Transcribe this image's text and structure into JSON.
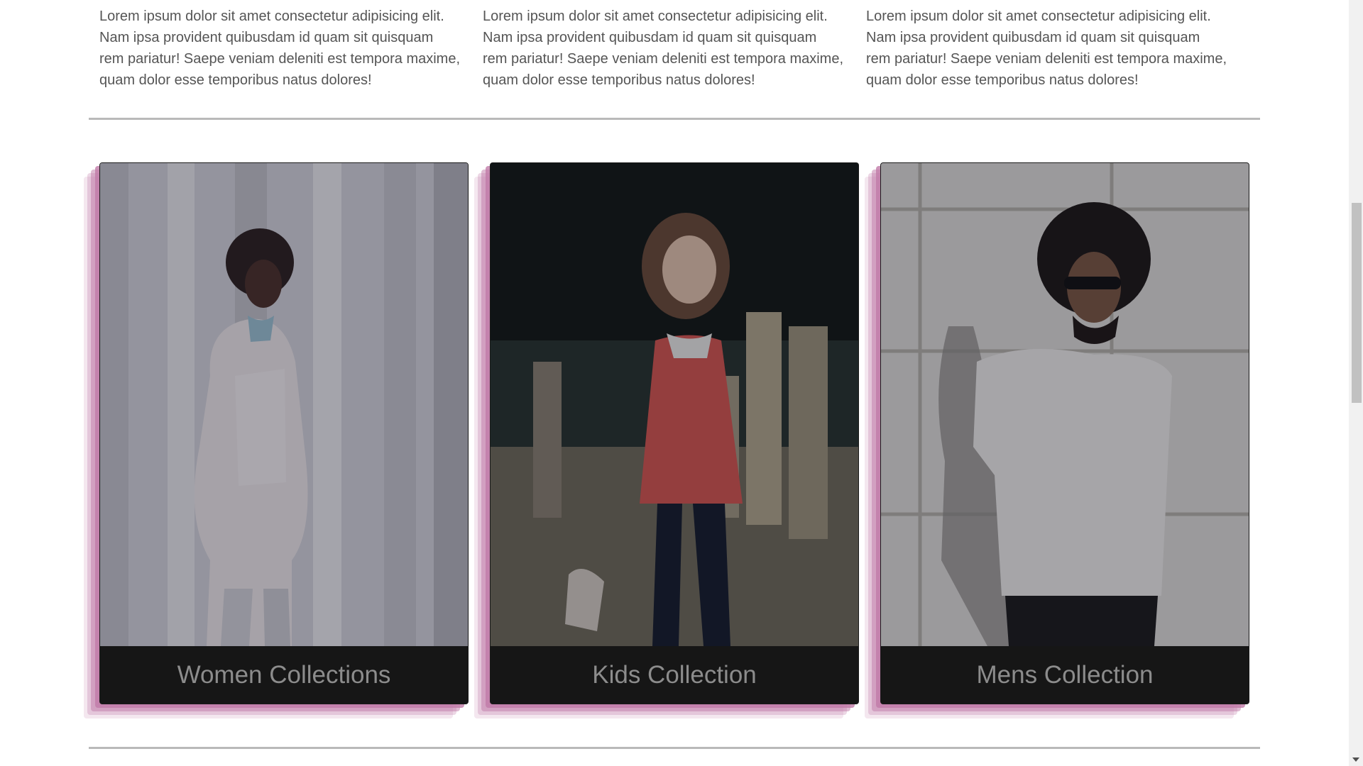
{
  "intro_columns": [
    {
      "text": "Lorem ipsum dolor sit amet consectetur adipisicing elit. Nam ipsa provident quibusdam id quam sit quisquam rem pariatur! Saepe veniam deleniti est tempora maxime, quam dolor esse temporibus natus dolores!"
    },
    {
      "text": "Lorem ipsum dolor sit amet consectetur adipisicing elit. Nam ipsa provident quibusdam id quam sit quisquam rem pariatur! Saepe veniam deleniti est tempora maxime, quam dolor esse temporibus natus dolores!"
    },
    {
      "text": "Lorem ipsum dolor sit amet consectetur adipisicing elit. Nam ipsa provident quibusdam id quam sit quisquam rem pariatur! Saepe veniam deleniti est tempora maxime, quam dolor esse temporibus natus dolores!"
    }
  ],
  "collections": [
    {
      "title": "Women Collections",
      "photo_icon": "woman-portrait-photo"
    },
    {
      "title": "Kids Collection",
      "photo_icon": "child-portrait-photo"
    },
    {
      "title": "Mens Collection",
      "photo_icon": "man-portrait-photo"
    }
  ],
  "colors": {
    "accent_shadow": "#c07aa8",
    "caption_bg": "#161616",
    "caption_text": "#8c8c8c",
    "body_text": "#555555"
  }
}
